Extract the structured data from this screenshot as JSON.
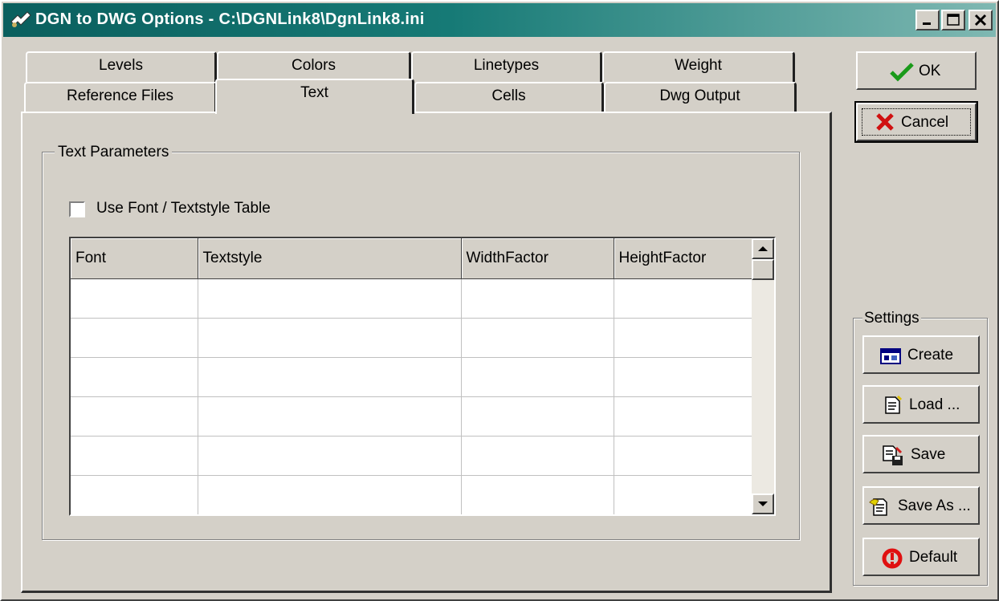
{
  "window": {
    "title": "DGN to DWG Options - C:\\DGNLink8\\DgnLink8.ini",
    "controls": {
      "minimize": "minimize-icon",
      "maximize": "maximize-icon",
      "close": "close-icon"
    }
  },
  "tabs": {
    "row_back": [
      "Levels",
      "Colors",
      "Linetypes",
      "Weight"
    ],
    "row_front": [
      "Reference Files",
      "Text",
      "Cells",
      "Dwg Output"
    ],
    "selected": "Text"
  },
  "text_panel": {
    "group_title": "Text Parameters",
    "checkbox_label": "Use Font / Textstyle Table",
    "checkbox_checked": false,
    "table": {
      "columns": [
        "Font",
        "Textstyle",
        "WidthFactor",
        "HeightFactor"
      ],
      "rows": [
        [
          "",
          "",
          "",
          ""
        ],
        [
          "",
          "",
          "",
          ""
        ],
        [
          "",
          "",
          "",
          ""
        ],
        [
          "",
          "",
          "",
          ""
        ],
        [
          "",
          "",
          "",
          ""
        ],
        [
          "",
          "",
          "",
          ""
        ]
      ]
    }
  },
  "actions": {
    "ok_label": "OK",
    "cancel_label": "Cancel"
  },
  "settings": {
    "title": "Settings",
    "create_label": "Create",
    "load_label": "Load ...",
    "save_label": "Save",
    "save_as_label": "Save As ...",
    "default_label": "Default"
  },
  "colors": {
    "title_start": "#0a5f5e",
    "title_end": "#7fb8b2",
    "face": "#d4d0c8",
    "ok_check": "#1a9a1a",
    "cancel_x": "#d01010",
    "default_icon": "#e01010"
  }
}
